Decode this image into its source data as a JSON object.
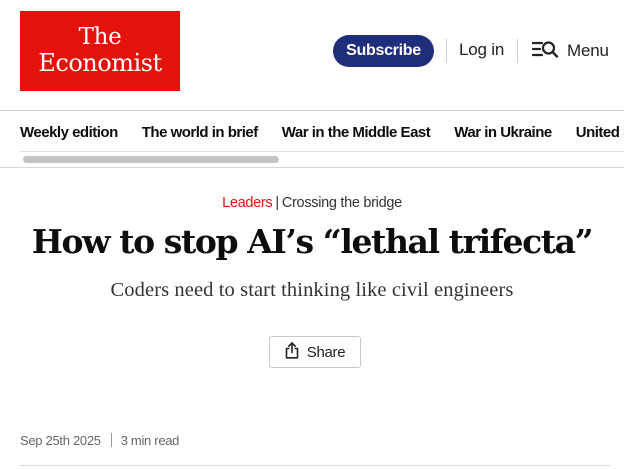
{
  "header": {
    "logo": {
      "line1": "The",
      "line2": "Economist"
    },
    "subscribe_label": "Subscribe",
    "login_label": "Log in",
    "menu_label": "Menu",
    "menu_icon": "search-menu-icon"
  },
  "nav": {
    "items": [
      {
        "label": "Weekly edition"
      },
      {
        "label": "The world in brief"
      },
      {
        "label": "War in the Middle East"
      },
      {
        "label": "War in Ukraine"
      },
      {
        "label": "United States"
      }
    ]
  },
  "article": {
    "section": "Leaders",
    "separator": "|",
    "flytitle": "Crossing the bridge",
    "headline": "How to stop AI’s “lethal trifecta”",
    "standfirst": "Coders need to start thinking like civil engineers",
    "share_label": "Share",
    "share_icon": "share-icon",
    "date": "Sep 25th 2025",
    "read_time": "3 min read"
  },
  "colors": {
    "brand_red": "#e3120b",
    "subscribe_navy": "#1f2e7a"
  }
}
